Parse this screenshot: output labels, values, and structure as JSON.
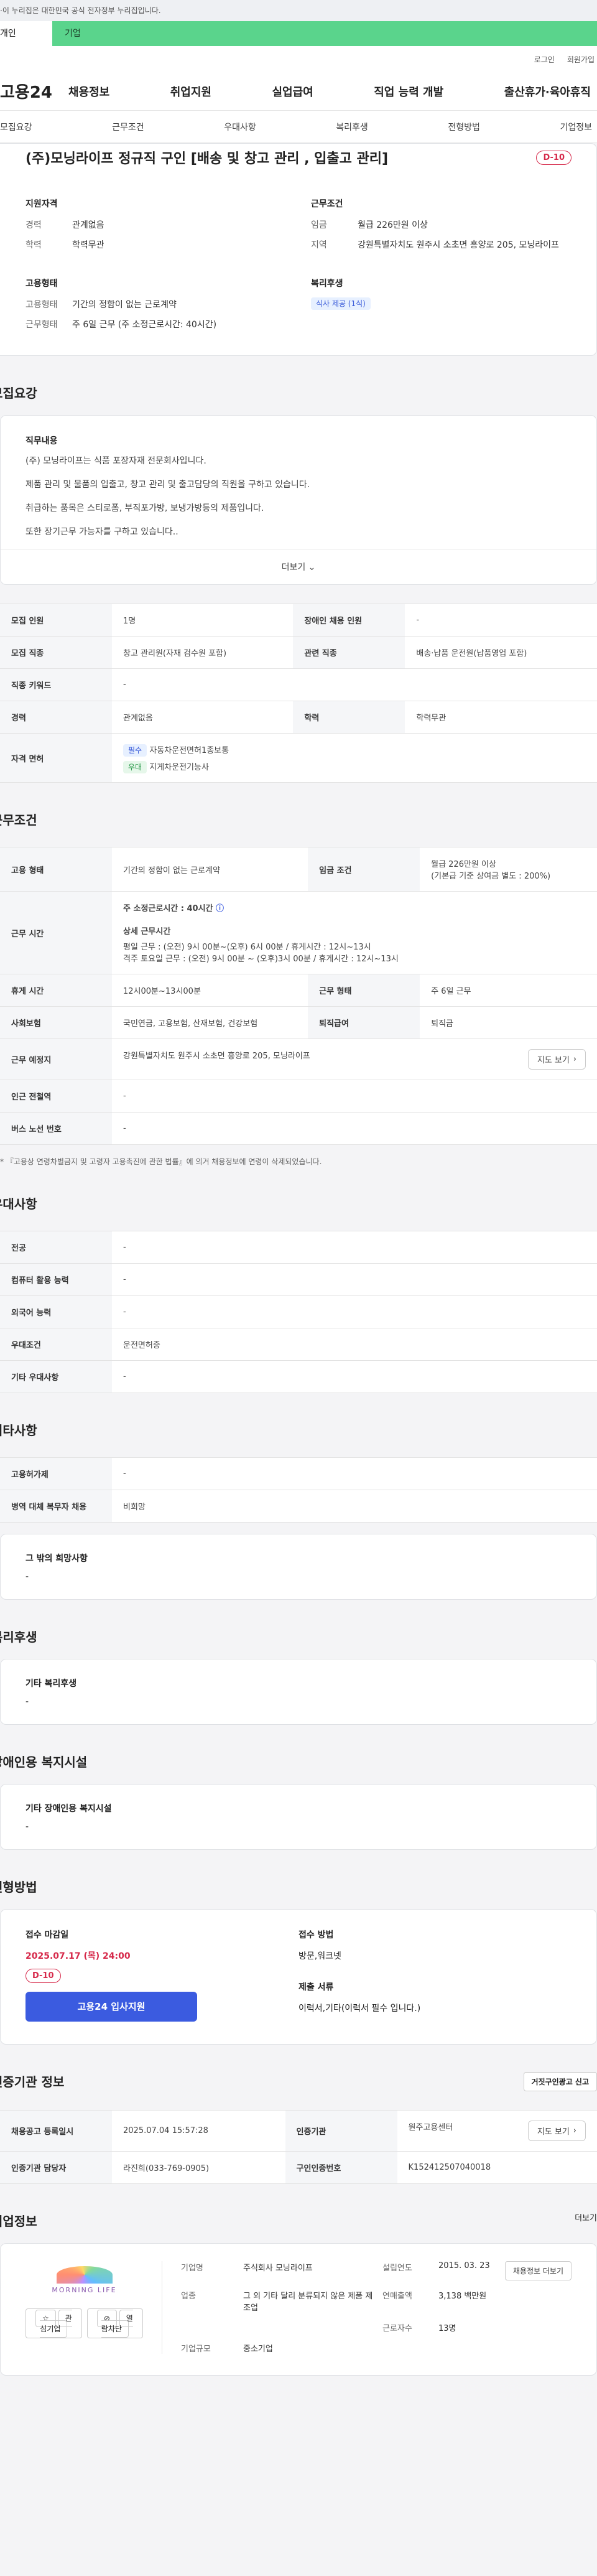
{
  "gov_bar": "·이 누리집은 대한민국 공식 전자정부 누리집입니다.",
  "tabs": [
    "개인",
    "기업"
  ],
  "toplinks": [
    "로그인",
    "회원가입"
  ],
  "logo": "고용24",
  "gnb": [
    "채용정보",
    "취업지원",
    "실업급여",
    "직업 능력 개발",
    "출산휴가·육아휴직"
  ],
  "subnav": [
    "모집요강",
    "근무조건",
    "우대사항",
    "복리후생",
    "전형방법",
    "기업정보"
  ],
  "job": {
    "title": "(주)모닝라이프 정규직 구인 [배송 및 창고 관리 , 입출고 관리]",
    "dday": "D-10",
    "qual_title": "지원자격",
    "career_k": "경력",
    "career_v": "관계없음",
    "edu_k": "학력",
    "edu_v": "학력무관",
    "emp_title": "고용형태",
    "emptype_k": "고용형태",
    "emptype_v": "기간의 정함이 없는 근로계약",
    "worktype_k": "근무형태",
    "worktype_v": "주 6일 근무 (주 소정근로시간: 40시간)",
    "cond_title": "근무조건",
    "wage_k": "임금",
    "wage_v": "월급 226만원 이상",
    "region_k": "지역",
    "region_v": "강원특별자치도 원주시 소초면 흥양로 205, 모닝라이프",
    "welfare_title": "복리후생",
    "welfare_chip": "식사 제공 (1식)"
  },
  "recruit": {
    "title": "모집요강",
    "duty_title": "직무내용",
    "lines": [
      "(주) 모닝라이프는 식품 포장자재 전문회사입니다.",
      "제품 관리 및 물품의 입출고, 창고 관리 및 출고담당의 직원을 구하고 있습니다.",
      "취급하는 품목은 스티로폼, 부직포가방, 보냉가방등의 제품입니다.",
      "또한 장기근무 가능자를 구하고 있습니다.."
    ],
    "more": "더보기",
    "rows": [
      [
        "모집 인원",
        "1명",
        "장애인 채용 인원",
        "-"
      ],
      [
        "모집 직종",
        "창고 관리원(자재 검수원 포함)",
        "관련 직종",
        "배송·납품 운전원(납품영업 포함)"
      ],
      [
        "직종 키워드",
        "-",
        "",
        ""
      ],
      [
        "경력",
        "관계없음",
        "학력",
        "학력무관"
      ]
    ],
    "license_k": "자격 면허",
    "licenses": [
      {
        "tag": "필수",
        "name": "자동차운전면허1종보통"
      },
      {
        "tag": "우대",
        "name": "지게차운전기능사"
      }
    ]
  },
  "work": {
    "title": "근무조건",
    "emp_k": "고용 형태",
    "emp_v": "기간의 정함이 없는 근로계약",
    "wage_k": "임금 조건",
    "wage_v1": "월급 226만원 이상",
    "wage_v2": "(기본급 기준 상여금 별도 : 200%)",
    "hours_k": "근무 시간",
    "hours_v1": "주 소정근로시간 : 40시간",
    "hours_sub": "상세 근무시간",
    "hours_l1": "평일 근무 : (오전) 9시 00분~(오후) 6시 00분 / 휴게시간 : 12시~13시",
    "hours_l2": "격주 토요일 근무 : (오전) 9시 00분 ~ (오후)3시 00분 / 휴게시간 : 12시~13시",
    "rest_k": "휴게 시간",
    "rest_v": "12시00분~13시00분",
    "form_k": "근무 형태",
    "form_v": "주 6일 근무",
    "ins_k": "사회보험",
    "ins_v": "국민연금, 고용보험, 산재보험, 건강보험",
    "pension_k": "퇴직급여",
    "pension_v": "퇴직금",
    "loc_k": "근무 예정지",
    "loc_v": "강원특별자치도 원주시 소초면 흥양로 205, 모닝라이프",
    "map_btn": "지도 보기",
    "station_k": "인근 전철역",
    "station_v": "-",
    "bus_k": "버스 노선 번호",
    "bus_v": "-",
    "note": "* 『고용상 연령차별금지 및 고령자 고용촉진에 관한 법률』에 의거 채용정보에 연령이 삭제되었습니다."
  },
  "pref": {
    "title": "우대사항",
    "rows": [
      [
        "전공",
        "-"
      ],
      [
        "컴퓨터 활용 능력",
        "-"
      ],
      [
        "외국어 능력",
        "-"
      ],
      [
        "우대조건",
        "운전면허증"
      ],
      [
        "기타 우대사항",
        "-"
      ]
    ]
  },
  "etc": {
    "title": "기타사항",
    "rows": [
      [
        "고용허가제",
        "-"
      ],
      [
        "병역 대체 복무자 채용",
        "비희망"
      ]
    ],
    "hope_title": "그 밖의 희망사항",
    "hope_v": "-"
  },
  "welfare": {
    "title": "복리후생",
    "box_title": "기타 복리후생",
    "box_v": "-"
  },
  "disabled": {
    "title": "장애인용 복지시설",
    "box_title": "기타 장애인용 복지시설",
    "box_v": "-"
  },
  "screening": {
    "title": "전형방법",
    "deadline_title": "접수 마감일",
    "deadline": "2025.07.17 (목) 24:00",
    "dday": "D-10",
    "apply_btn": "고용24 입사지원",
    "method_title": "접수 방법",
    "method_v": "방문,워크넷",
    "docs_title": "제출 서류",
    "docs_v": "이력서,기타(이력서 필수 입니다.)"
  },
  "agency": {
    "title": "인증기관 정보",
    "report_btn": "거짓구인광고 신고",
    "rows": [
      [
        "채용공고 등록일시",
        "2025.07.04 15:57:28",
        "인증기관",
        "원주고용센터"
      ],
      [
        "인증기관 담당자",
        "라진희(033-769-0905)",
        "구인인증번호",
        "K152412507040018"
      ]
    ],
    "map_btn": "지도 보기"
  },
  "companyinfo": {
    "title": "기업정보",
    "more": "더보기",
    "logo_text": "MORNING LIFE",
    "btn_fav": "관심기업",
    "btn_block": "열람차단",
    "rows": [
      [
        "기업명",
        "주식회사 모닝라이프",
        "설립연도",
        "2015. 03. 23"
      ],
      [
        "업종",
        "그 외 기타 달리 분류되지 않은 제품 제조업",
        "연매출액",
        "3,138 백만원"
      ],
      [
        "",
        "",
        "근로자수",
        "13명"
      ],
      [
        "기업규모",
        "중소기업",
        "",
        ""
      ]
    ],
    "hire_btn": "채용정보 더보기"
  }
}
